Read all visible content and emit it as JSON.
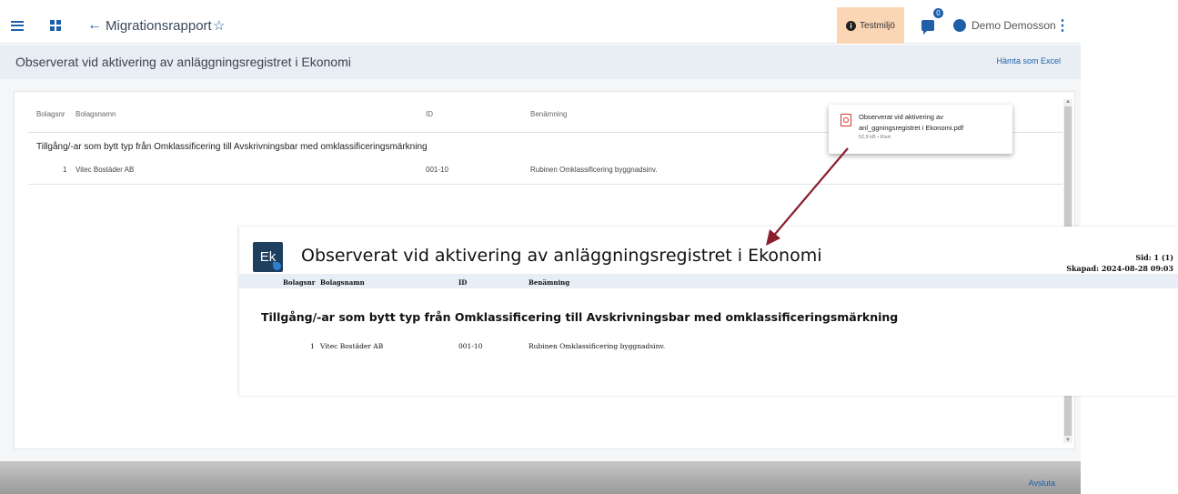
{
  "header": {
    "back_arrow": "←",
    "title": "Migrationsrapport",
    "star": "☆",
    "environment": "Testmiljö",
    "environment_icon": "i",
    "notifications_count": "0",
    "user_name": "Demo Demosson",
    "more": "⋮"
  },
  "subheader": {
    "title": "Observerat vid aktivering av anläggningsregistret i Ekonomi",
    "export_link": "Hämta som Excel"
  },
  "table": {
    "columns": {
      "company_no": "Bolagsnr",
      "company_name": "Bolagsnamn",
      "id": "ID",
      "description": "Benämning"
    },
    "group_title": "Tillgång/-ar som bytt typ från Omklassificering till Avskrivningsbar med omklassificeringsmärkning",
    "rows": [
      {
        "company_no": "1",
        "company_name": "Vitec Bostäder AB",
        "id": "001-10",
        "description": "Rubinen Omklassificering byggnadsinv."
      }
    ]
  },
  "download": {
    "file_line1": "Observerat vid aktivering av",
    "file_line2": "anl_ggningsregistret i Ekonomi.pdf",
    "meta": "52,9 kB • Klart"
  },
  "pdf": {
    "logo": "Ek",
    "title": "Observerat vid aktivering av anläggningsregistret i Ekonomi",
    "page": "Sid: 1 (1)",
    "created": "Skapad: 2024-08-28 09:03",
    "columns": {
      "company_no": "Bolagsnr",
      "company_name": "Bolagsnamn",
      "id": "ID",
      "description": "Benämning"
    },
    "group_title": "Tillgång/-ar som bytt typ från Omklassificering till Avskrivningsbar med omklassificeringsmärkning",
    "row": {
      "company_no": "1",
      "company_name": "Vitec Bostäder AB",
      "id": "001-10",
      "description": "Rubinen Omklassificering byggnadsinv."
    }
  },
  "footer": {
    "close_label": "Avsluta"
  },
  "colors": {
    "accent": "#1f5fa8",
    "env_badge": "#fbd6b4",
    "arrow": "#8b1e2d",
    "subheader_bg": "#e9eef5"
  }
}
